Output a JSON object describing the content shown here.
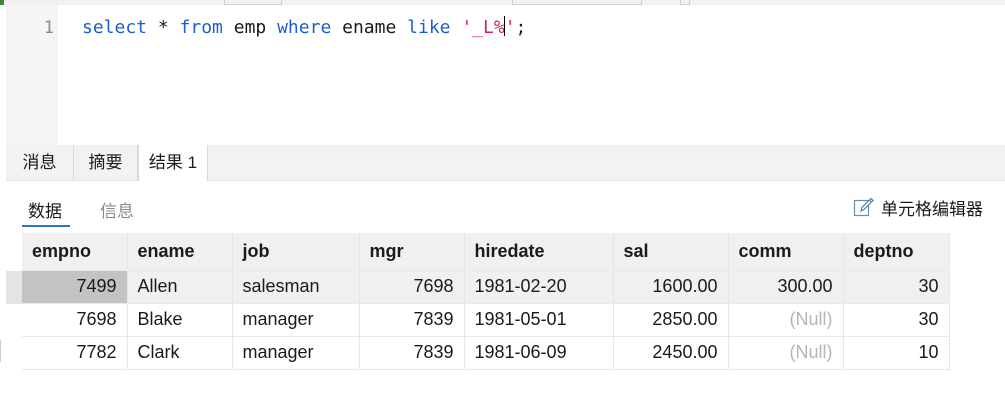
{
  "editor": {
    "line_number": "1",
    "tokens": {
      "kw_select": "select",
      "star": " * ",
      "kw_from": "from",
      "table": " emp ",
      "kw_where": "where",
      "column": " ename ",
      "kw_like": "like",
      "space": " ",
      "str_before_caret": "'_L%",
      "str_after_caret": "'",
      "terminator": ";"
    }
  },
  "result_tabs": {
    "messages": "消息",
    "summary": "摘要",
    "result1": "结果 1"
  },
  "subtabs": {
    "data": "数据",
    "info": "信息",
    "cell_editor": "单元格编辑器"
  },
  "grid": {
    "columns": [
      "empno",
      "ename",
      "job",
      "mgr",
      "hiredate",
      "sal",
      "comm",
      "deptno"
    ],
    "rows": [
      [
        "7499",
        "Allen",
        "salesman",
        "7698",
        "1981-02-20",
        "1600.00",
        "300.00",
        "30"
      ],
      [
        "7698",
        "Blake",
        "manager",
        "7839",
        "1981-05-01",
        "2850.00",
        "(Null)",
        "30"
      ],
      [
        "7782",
        "Clark",
        "manager",
        "7839",
        "1981-06-09",
        "2450.00",
        "(Null)",
        "10"
      ]
    ]
  },
  "colors": {
    "keyword": "#1a5fd0",
    "string": "#d4264a",
    "active_underline": "#2a6fd6",
    "null_text": "#b5b5b5"
  },
  "icons": {
    "cell_editor": "edit-pencil-icon"
  }
}
